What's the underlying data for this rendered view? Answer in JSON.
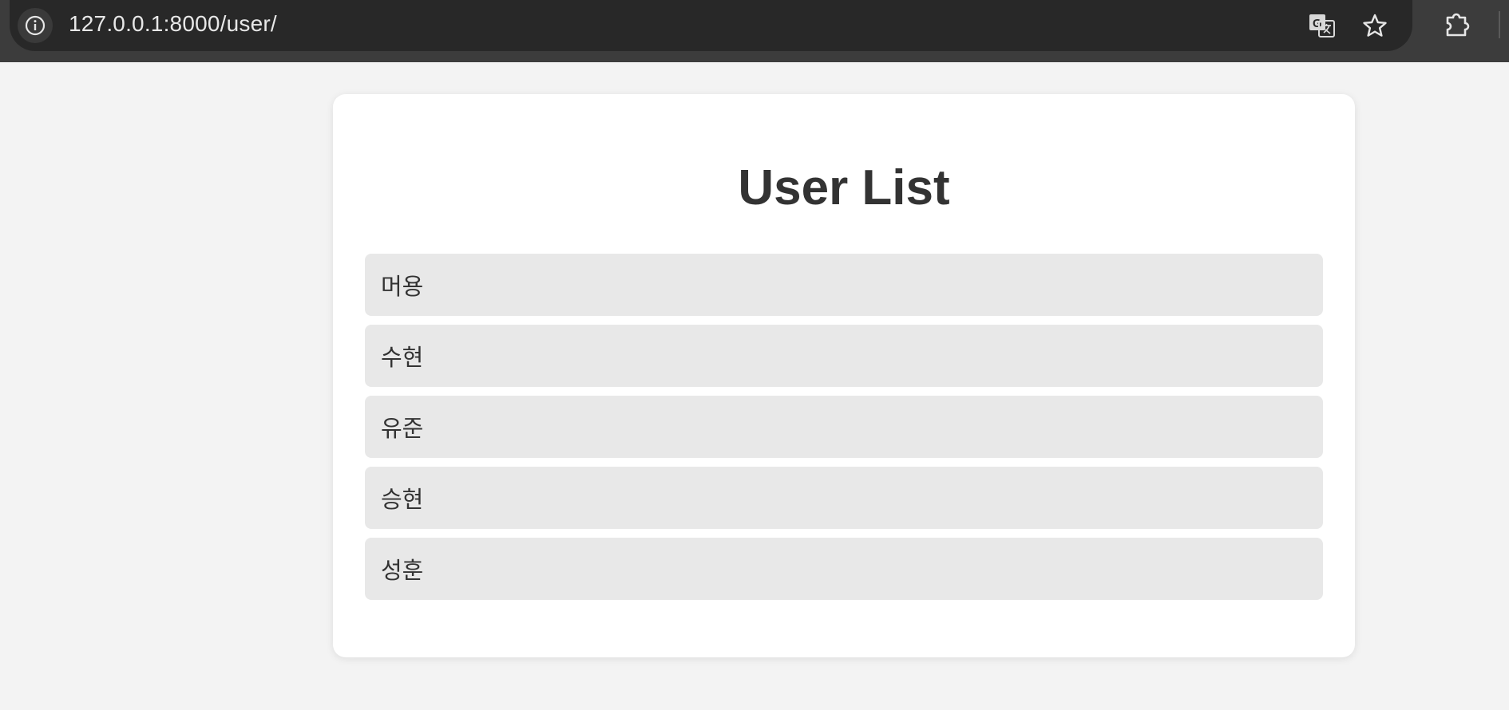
{
  "browser": {
    "url": "127.0.0.1:8000/user/"
  },
  "page": {
    "title": "User List",
    "users": [
      {
        "name": "머용"
      },
      {
        "name": "수현"
      },
      {
        "name": "유준"
      },
      {
        "name": "승현"
      },
      {
        "name": "성훈"
      }
    ]
  },
  "icons": {
    "site_info": "info-icon",
    "translate": "translate-icon",
    "bookmark": "star-icon",
    "extensions": "puzzle-icon"
  },
  "colors": {
    "page_background": "#f3f3f3",
    "card_background": "#ffffff",
    "item_background": "#e8e8e8",
    "text": "#333333",
    "toolbar": "#3c3c3c"
  }
}
